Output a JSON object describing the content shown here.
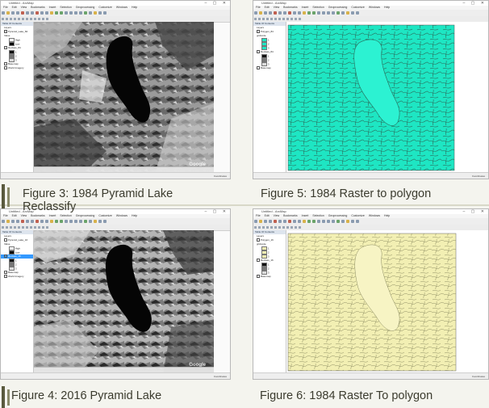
{
  "app": {
    "title": "Untitled - ArcMap",
    "menu": [
      "File",
      "Edit",
      "View",
      "Bookmarks",
      "Insert",
      "Selection",
      "Geoprocessing",
      "Customize",
      "Windows",
      "Help"
    ],
    "toc_header": "Table Of Contents",
    "status": "Coordinates"
  },
  "figures": [
    {
      "caption": "Figure 3: 1984 Pyramid Lake",
      "caption2": "Reclassify",
      "map_style": "grayscale",
      "watermark": "Google",
      "layers": [
        "Layers",
        "Pyramid_Lake_84",
        "Value",
        "High",
        "Low",
        "Reclass_84",
        "1",
        "2",
        "3",
        "Basemap",
        "World Imagery"
      ]
    },
    {
      "caption": "Figure 5: 1984 Raster to polygon",
      "map_style": "cyan-polygon",
      "colors": {
        "fill": "#1ee6c3",
        "lines": "#2a6b5a"
      },
      "layers": [
        "Layers",
        "Polygon_84",
        "gridcode",
        "1",
        "2",
        "3",
        "Reclass_84",
        "1",
        "2",
        "3",
        "Basemap"
      ]
    },
    {
      "caption": "Figure 4: 2016 Pyramid Lake",
      "map_style": "grayscale",
      "watermark": "Google",
      "layers": [
        "Layers",
        "Pyramid_Lake_16",
        "Value",
        "High",
        "Low",
        "Reclass_16",
        "1",
        "2",
        "3",
        "Basemap",
        "World Imagery"
      ]
    },
    {
      "caption": "Figure 6: 1984 Raster To polygon",
      "map_style": "yellow-polygon",
      "colors": {
        "fill": "#f2efb3",
        "lines": "#8a8a60"
      },
      "layers": [
        "Layers",
        "Polygon_16",
        "gridcode",
        "1",
        "2",
        "3",
        "Reclass_16",
        "1",
        "2",
        "3",
        "Basemap"
      ]
    }
  ]
}
